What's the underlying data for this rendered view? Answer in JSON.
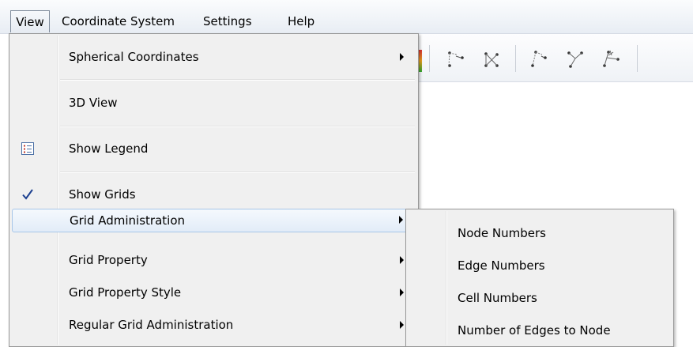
{
  "menubar": {
    "items": [
      {
        "label": "View"
      },
      {
        "label": "Coordinate System"
      },
      {
        "label": "Settings"
      },
      {
        "label": "Help"
      }
    ]
  },
  "view_menu": {
    "items": [
      {
        "label": "Spherical Coordinates",
        "submenu": true
      },
      {
        "label": "3D View"
      },
      {
        "label": "Show Legend",
        "icon": "legend-list-icon"
      },
      {
        "label": "Show Grids",
        "checked": true,
        "icon": "checkmark-icon"
      },
      {
        "label": "Grid Administration",
        "submenu": true,
        "highlighted": true
      },
      {
        "label": "Grid Property",
        "submenu": true
      },
      {
        "label": "Grid Property Style",
        "submenu": true
      },
      {
        "label": "Regular Grid Administration",
        "submenu": true
      }
    ]
  },
  "grid_admin_submenu": {
    "items": [
      {
        "label": "Node Numbers"
      },
      {
        "label": "Edge Numbers"
      },
      {
        "label": "Cell Numbers"
      },
      {
        "label": "Number of Edges to Node"
      }
    ]
  },
  "toolbar": {
    "icons": [
      "add-node-icon",
      "delete-node-icon",
      "move-node-icon",
      "split-edge-icon",
      "merge-node-icon"
    ]
  },
  "colors": {
    "menu_bg": "#f0f0f0",
    "highlight_border": "#a8c6e8",
    "check_color": "#1b3f8f"
  }
}
